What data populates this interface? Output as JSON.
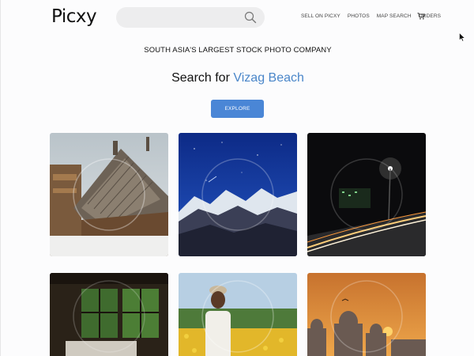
{
  "header": {
    "logo_text": "Picxy",
    "search": {
      "placeholder": "",
      "value": "",
      "icon": "search-icon"
    },
    "nav": [
      {
        "label": "SELL ON PICXY"
      },
      {
        "label": "PHOTOS"
      },
      {
        "label": "MAP SEARCH"
      },
      {
        "label": "ORDERS"
      }
    ],
    "cart_icon": "cart-icon"
  },
  "hero": {
    "tagline": "SOUTH ASIA'S LARGEST STOCK PHOTO COMPANY",
    "search_prefix": "Search for",
    "search_query": "Vizag Beach",
    "button_label": "EXPLORE"
  },
  "gallery": [
    {
      "subject": "wooden temple roof"
    },
    {
      "subject": "snowy mountains under starry sky"
    },
    {
      "subject": "highway light trails at night"
    },
    {
      "subject": "room with open windows"
    },
    {
      "subject": "elderly man in flower field"
    },
    {
      "subject": "temple domes at sunset"
    }
  ],
  "colors": {
    "accent": "#4a86d6",
    "query_text": "#4a86c9",
    "background": "#fcfcfd"
  }
}
